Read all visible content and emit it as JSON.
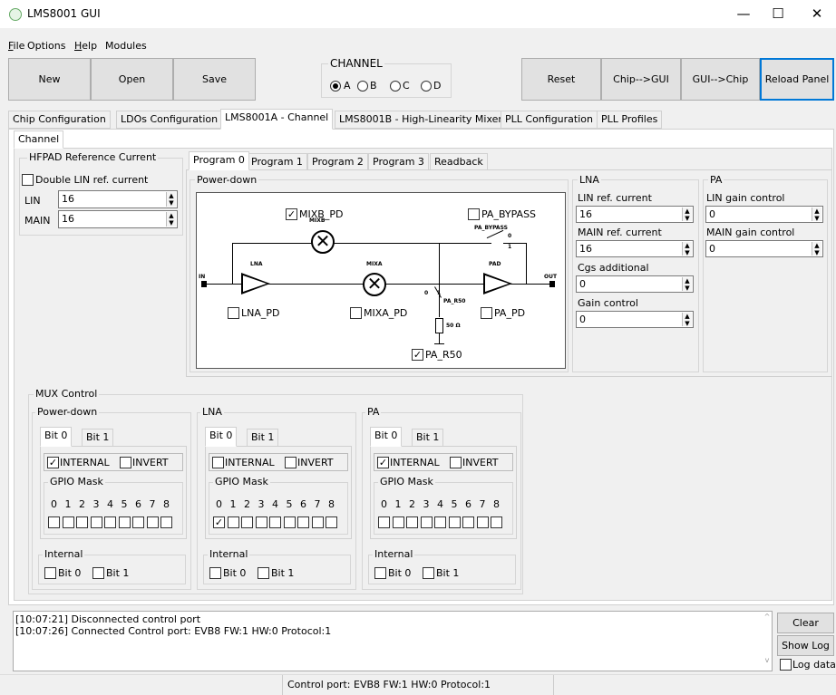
{
  "window": {
    "title": "LMS8001 GUI",
    "min": "—",
    "max": "☐",
    "close": "✕"
  },
  "menu": [
    "File",
    "Options",
    "Help",
    "Modules"
  ],
  "toolbar": {
    "new": "New",
    "open": "Open",
    "save": "Save",
    "channel_title": "CHANNEL",
    "channels": [
      {
        "label": "A",
        "selected": true
      },
      {
        "label": "B",
        "selected": false
      },
      {
        "label": "C",
        "selected": false
      },
      {
        "label": "D",
        "selected": false
      }
    ],
    "reset": "Reset",
    "chip_gui": "Chip-->GUI",
    "gui_chip": "GUI-->Chip",
    "reload": "Reload Panel"
  },
  "tabs": [
    "Chip Configuration",
    "LDOs Configuration",
    "LMS8001A - Channel",
    "LMS8001B - High-Linearity Mixer",
    "PLL Configuration",
    "PLL Profiles"
  ],
  "subtab": "Channel",
  "hfpad": {
    "title": "HFPAD Reference Current",
    "double": "Double LIN ref. current",
    "lin_label": "LIN",
    "lin_value": "16",
    "main_label": "MAIN",
    "main_value": "16"
  },
  "program_tabs": [
    "Program 0",
    "Program 1",
    "Program 2",
    "Program 3",
    "Readback"
  ],
  "powerdown": {
    "title": "Power-down",
    "mixb_pd": "MIXB_PD",
    "pa_bypass_cb": "PA_BYPASS",
    "lna_pd": "LNA_PD",
    "mixa_pd": "MIXA_PD",
    "pa_pd": "PA_PD",
    "pa_r50_cb": "PA_R50",
    "schem": {
      "mixb": "MIXB",
      "pa_bypass": "PA_BYPASS",
      "lna": "LNA",
      "mixa": "MIXA",
      "pad": "PAD",
      "in": "IN",
      "out": "OUT",
      "pa_r50": "PA_R50",
      "ohm": "50 Ω",
      "zero": "0",
      "one": "1"
    }
  },
  "lna": {
    "title": "LNA",
    "lin_ref": "LIN ref. current",
    "lin_ref_val": "16",
    "main_ref": "MAIN ref. current",
    "main_ref_val": "16",
    "cgs": "Cgs additional",
    "cgs_val": "0",
    "gain": "Gain control",
    "gain_val": "0"
  },
  "pa": {
    "title": "PA",
    "lin_gain": "LIN gain control",
    "lin_gain_val": "0",
    "main_gain": "MAIN gain control",
    "main_gain_val": "0"
  },
  "mux": {
    "title": "MUX Control",
    "internal_label": "INTERNAL",
    "invert_label": "INVERT",
    "gpio_mask": "GPIO Mask",
    "internal_group": "Internal",
    "bits": [
      "0",
      "1",
      "2",
      "3",
      "4",
      "5",
      "6",
      "7",
      "8"
    ],
    "bit_tabs": [
      "Bit 0",
      "Bit 1"
    ],
    "groups": [
      {
        "title": "Power-down",
        "internal": true,
        "invert": false,
        "mask": [
          false,
          false,
          false,
          false,
          false,
          false,
          false,
          false,
          false
        ]
      },
      {
        "title": "LNA",
        "internal": false,
        "invert": false,
        "mask": [
          true,
          false,
          false,
          false,
          false,
          false,
          false,
          false,
          false
        ]
      },
      {
        "title": "PA",
        "internal": true,
        "invert": false,
        "mask": [
          false,
          false,
          false,
          false,
          false,
          false,
          false,
          false,
          false
        ]
      }
    ]
  },
  "log": {
    "lines": [
      "[10:07:21] Disconnected control port",
      "[10:07:26] Connected Control port: EVB8 FW:1 HW:0 Protocol:1"
    ],
    "clear": "Clear",
    "show_log": "Show Log",
    "log_data": "Log data"
  },
  "status": "Control port: EVB8 FW:1 HW:0 Protocol:1"
}
